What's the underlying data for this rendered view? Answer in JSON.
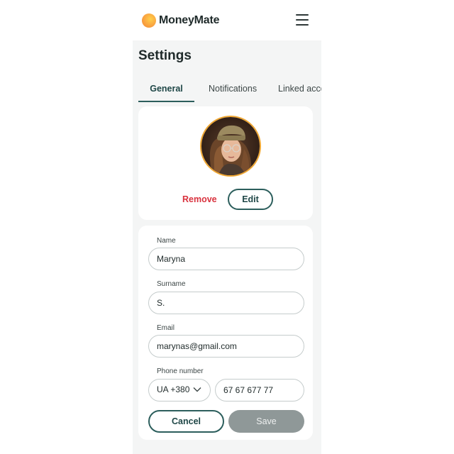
{
  "app": {
    "brand": "MoneyMate",
    "logo_icon": "orange-circle-logo-icon",
    "menu_icon": "hamburger-menu-icon"
  },
  "page": {
    "title": "Settings"
  },
  "tabs": [
    {
      "label": "General",
      "active": true
    },
    {
      "label": "Notifications",
      "active": false
    },
    {
      "label": "Linked accounts",
      "active": false
    }
  ],
  "profile": {
    "avatar_alt": "user-photo",
    "remove_label": "Remove",
    "edit_label": "Edit"
  },
  "form": {
    "name": {
      "label": "Name",
      "value": "Maryna"
    },
    "surname": {
      "label": "Surname",
      "value": "S."
    },
    "email": {
      "label": "Email",
      "value": "marynas@gmail.com"
    },
    "phone": {
      "label": "Phone number",
      "country_code": "UA +380",
      "number": "67 67 677 77"
    },
    "cancel_label": "Cancel",
    "save_label": "Save"
  },
  "colors": {
    "accent": "#2c5e5c",
    "danger": "#d9333f",
    "avatar_ring": "#f0a732",
    "disabled_button": "#8f9898",
    "background": "#f4f5f5"
  }
}
